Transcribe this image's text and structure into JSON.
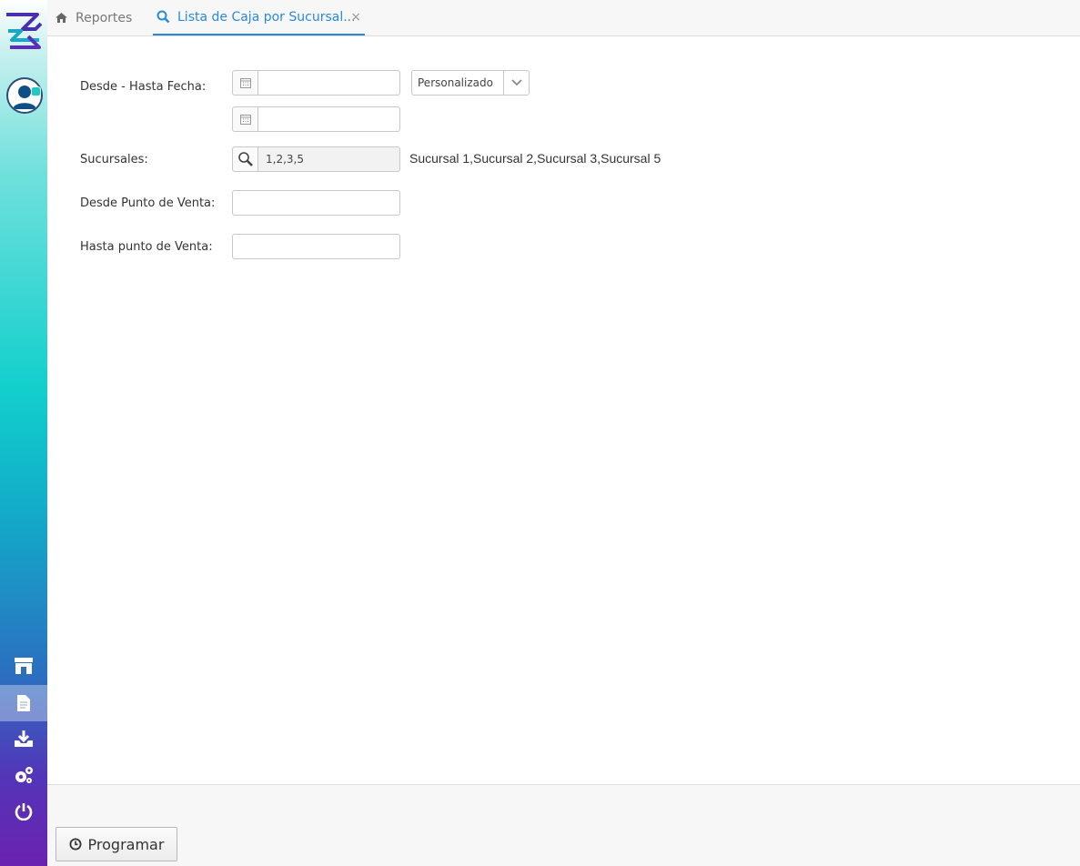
{
  "tabs": {
    "home_label": "Reportes",
    "active_label": "Lista de Caja por Sucursal...",
    "close_glyph": "×"
  },
  "form": {
    "fecha_label": "Desde - Hasta Fecha:",
    "fecha_desde_value": "",
    "fecha_hasta_value": "",
    "periodo_selected": "Personalizado",
    "sucursales_label": "Sucursales:",
    "sucursales_value": "1,2,3,5",
    "sucursales_names": "Sucursal 1,Sucursal 2,Sucursal 3,Sucursal 5",
    "desde_pv_label": "Desde Punto de Venta:",
    "desde_pv_value": "",
    "hasta_pv_label": "Hasta punto de Venta:",
    "hasta_pv_value": ""
  },
  "footer": {
    "programar_label": "Programar"
  },
  "icons": {
    "logo": "logo-icon",
    "avatar": "user-avatar-icon",
    "store": "store-icon",
    "document": "document-icon",
    "download": "download-icon",
    "settings": "gears-icon",
    "power": "power-icon",
    "home": "home-icon",
    "search": "search-icon",
    "calendar": "calendar-icon",
    "magnifier": "magnifier-icon",
    "clock": "clock-icon",
    "chevron": "chevron-down-icon"
  },
  "colors": {
    "accent": "#2a8ad6",
    "sidebar_top": "#12cfcc",
    "sidebar_bottom": "#6b22b0"
  }
}
